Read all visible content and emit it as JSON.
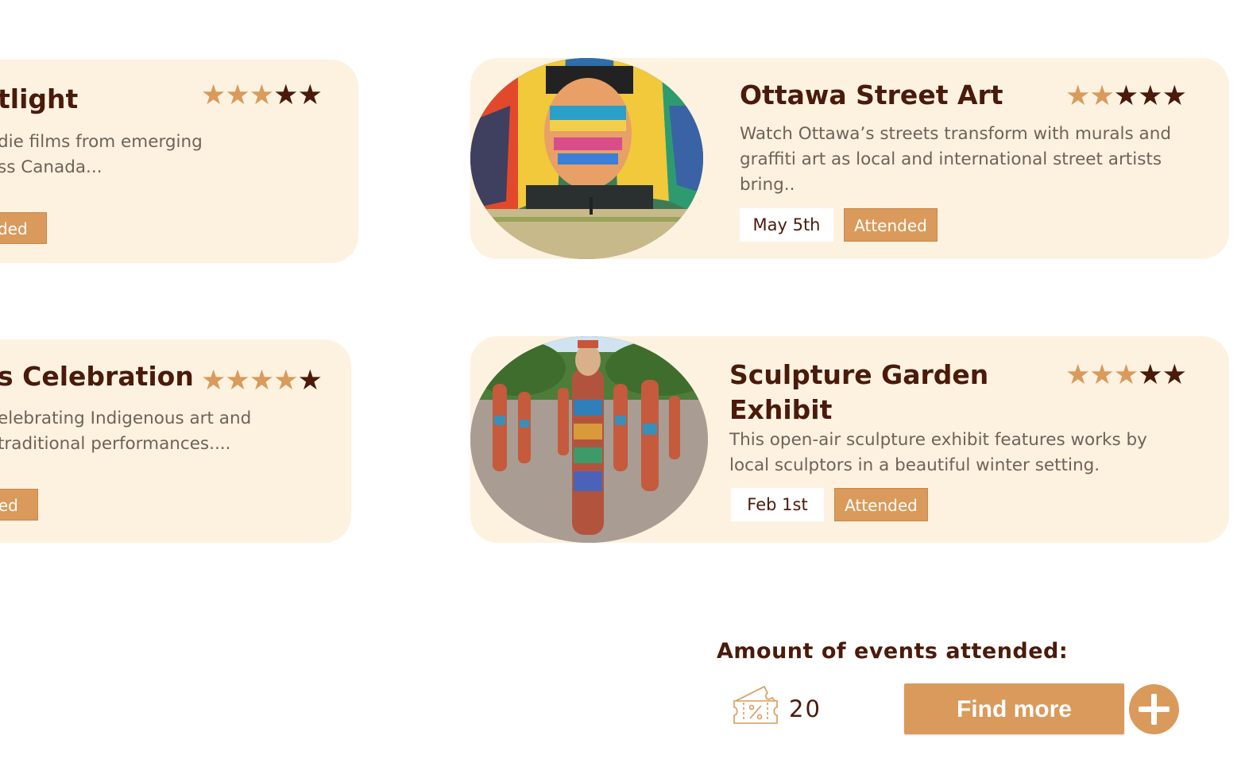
{
  "left_cards": [
    {
      "title": "tlight",
      "desc_lines": [
        "die films from emerging",
        "ss Canada..."
      ],
      "status": "nded",
      "stars": [
        true,
        true,
        true,
        false,
        false
      ]
    },
    {
      "title": "s Celebration",
      "desc_lines": [
        "elebrating Indigenous art and",
        "traditional performances...."
      ],
      "status": "ded",
      "stars": [
        true,
        true,
        true,
        true,
        false
      ]
    }
  ],
  "cards": [
    {
      "title": "Ottawa Street Art",
      "description": "Watch Ottawa’s streets transform with murals and graffiti art as local and international street artists bring..",
      "date": "May 5th",
      "status": "Attended",
      "stars": [
        true,
        true,
        false,
        false,
        false
      ]
    },
    {
      "title_line1": "Sculpture Garden",
      "title_line2": "Exhibit",
      "description": "This open-air sculpture exhibit features works by local sculptors in a beautiful winter setting.",
      "date": "Feb 1st",
      "status": "Attended",
      "stars": [
        true,
        true,
        true,
        false,
        false
      ]
    }
  ],
  "footer": {
    "label": "Amount of events attended:",
    "count": "20",
    "ticket_icon": "ticket-percent-icon",
    "find_more": "Find more",
    "add_icon": "plus-icon"
  },
  "colors": {
    "card_bg": "#fdf2e0",
    "accent": "#d99a5b",
    "text_dark": "#4a1a0a",
    "text_muted": "#6f6258"
  }
}
